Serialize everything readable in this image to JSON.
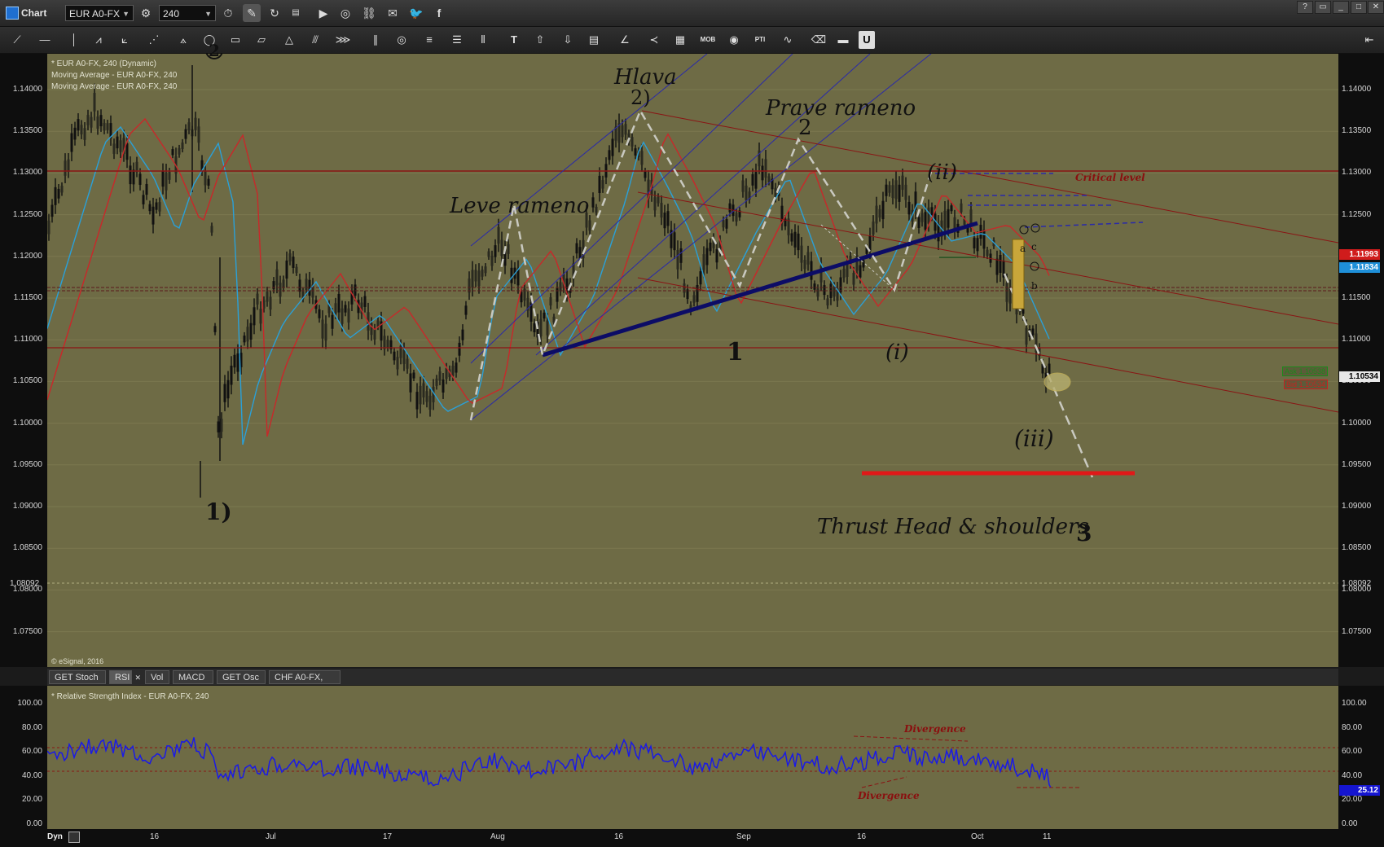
{
  "window": {
    "title": "Chart",
    "symbol": "EUR A0-FX",
    "interval": "240"
  },
  "legend": {
    "line1": "* EUR A0-FX, 240 (Dynamic)",
    "line2": "Moving Average - EUR A0-FX, 240",
    "line3": "Moving Average - EUR A0-FX, 240",
    "copyright": "© eSignal, 2016"
  },
  "price_axis": [
    "1.14000",
    "1.13500",
    "1.13000",
    "1.12500",
    "1.12000",
    "1.11500",
    "1.11000",
    "1.10500",
    "1.10000",
    "1.09500",
    "1.09000",
    "1.08500",
    "1.08000",
    "1.07500"
  ],
  "price_tags": {
    "red": "1.11993",
    "blue": "1.11834",
    "black": "1.10534",
    "ask": "Ask 1.10538",
    "bid": "Bid 1.10534",
    "left_level": "1.08092",
    "right_level": "1.08092"
  },
  "annotations": {
    "hlava": "Hlava",
    "hlava_2": "2)",
    "prave_rameno": "Prave rameno",
    "prave_2": "2",
    "leve_rameno": "Leve rameno",
    "wave_1_paren": "1)",
    "wave_1": "1",
    "wave_i": "(i)",
    "wave_ii": "(ii)",
    "wave_iii": "(iii)",
    "critical_level": "Critical level",
    "thrust": "Thrust  Head & shoulders",
    "wave_3": "3",
    "top_marker": "2",
    "circ_a": "a",
    "circ_c": "c",
    "circ_b": "b"
  },
  "tabs": [
    "GET Stoch",
    "RSI",
    "Vol",
    "MACD",
    "GET Osc",
    "CHF A0-FX, 240"
  ],
  "rsi": {
    "legend": "* Relative Strength Index - EUR A0-FX, 240",
    "axis": [
      "100.00",
      "80.00",
      "60.00",
      "40.00",
      "20.00",
      "0.00"
    ],
    "value": "25.12",
    "div_top": "Divergence",
    "div_bottom": "Divergence"
  },
  "time_axis": {
    "dyn": "Dyn",
    "labels": [
      "16",
      "Jul",
      "17",
      "Aug",
      "16",
      "Sep",
      "16",
      "Oct",
      "11"
    ]
  },
  "colors": {
    "pane": "#6e6b45",
    "rsi_line": "#1a1ae6",
    "ma_red": "#c8282a",
    "ma_blue": "#2aa0d8",
    "trend_thick": "#0c0c66"
  }
}
